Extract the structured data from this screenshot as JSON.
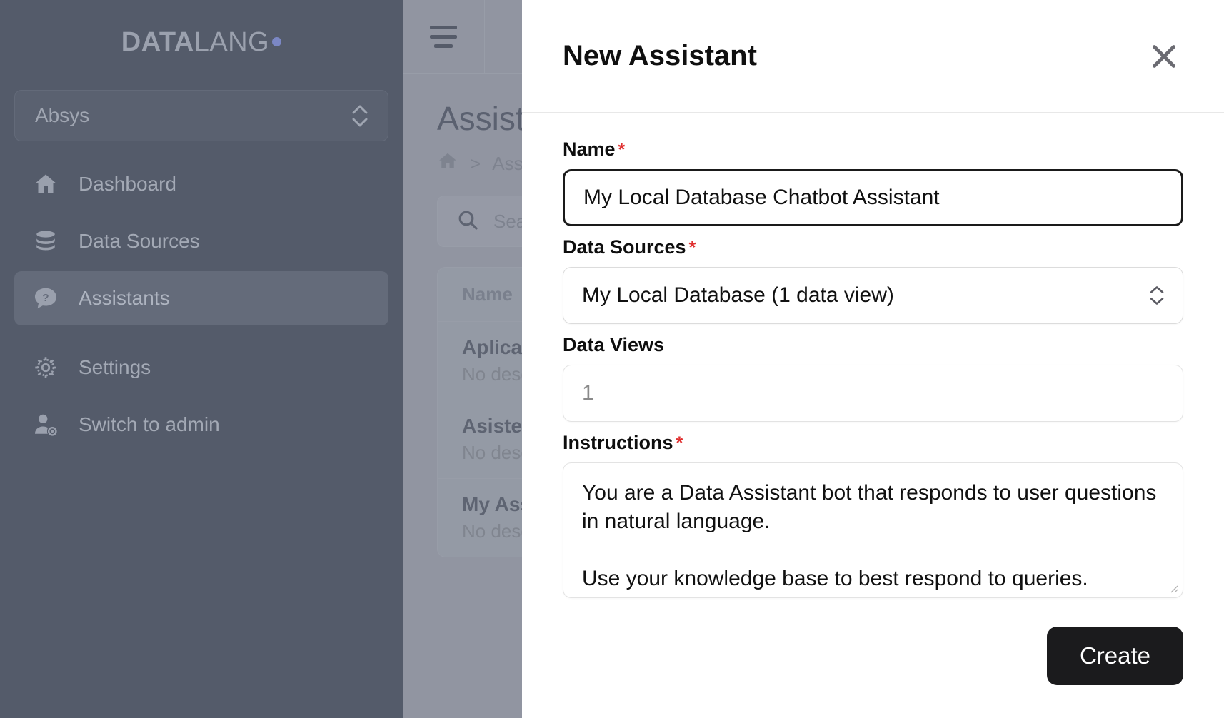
{
  "sidebar": {
    "logo": {
      "bold_part": "DATA",
      "light_part": "LANG",
      "dot_color": "#7b87c4"
    },
    "workspace": {
      "name": "Absys",
      "icon": "chevron-updown-icon"
    },
    "items": [
      {
        "label": "Dashboard",
        "icon": "home-icon",
        "active": false
      },
      {
        "label": "Data Sources",
        "icon": "database-icon",
        "active": false
      },
      {
        "label": "Assistants",
        "icon": "chat-question-icon",
        "active": true
      },
      {
        "label": "Settings",
        "icon": "gear-icon",
        "active": false
      },
      {
        "label": "Switch to admin",
        "icon": "user-gear-icon",
        "active": false
      }
    ]
  },
  "main": {
    "menu_icon": "hamburger-icon",
    "page_title": "Assistants",
    "breadcrumb": {
      "home_icon": "home-icon",
      "separator": ">",
      "current": "Assistants"
    },
    "search": {
      "icon": "search-icon",
      "placeholder": "Search"
    },
    "table": {
      "headers": [
        "Name"
      ],
      "rows": [
        {
          "name": "Aplicacion",
          "description": "No description"
        },
        {
          "name": "Asistente",
          "description": "No description"
        },
        {
          "name": "My Assistant",
          "description": "No description"
        }
      ]
    }
  },
  "modal": {
    "title": "New Assistant",
    "close_icon": "close-icon",
    "fields": {
      "name": {
        "label": "Name",
        "required_marker": "*",
        "value": "My Local Database Chatbot Assistant"
      },
      "data_sources": {
        "label": "Data Sources",
        "required_marker": "*",
        "value": "My Local Database (1 data view)",
        "icon": "chevron-updown-icon"
      },
      "data_views": {
        "label": "Data Views",
        "required_marker": "",
        "value": "1"
      },
      "instructions": {
        "label": "Instructions",
        "required_marker": "*",
        "value": "You are a Data Assistant bot that responds to user questions in natural language.\n\nUse your knowledge base to best respond to queries."
      }
    },
    "create_button": "Create"
  },
  "colors": {
    "sidebar_bg": "#545b6a",
    "overlay_bg": "#9195a1",
    "accent_dot": "#7b87c4",
    "required_red": "#e03131",
    "button_dark": "#1b1b1d"
  }
}
